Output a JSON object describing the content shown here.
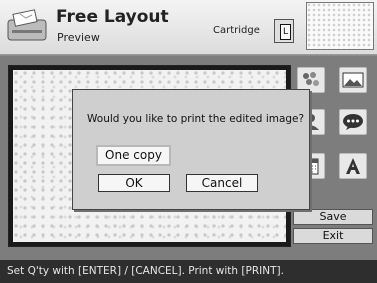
{
  "header": {
    "title": "Free Layout",
    "subtitle": "Preview",
    "cartridge_label": "Cartridge",
    "cartridge_size": "L"
  },
  "toolbar": {
    "icons": [
      "stamp-icon",
      "image-icon",
      "person-icon",
      "speech-bubble-icon",
      "calendar-icon",
      "text-icon"
    ]
  },
  "side_buttons": {
    "save": "Save",
    "exit": "Exit"
  },
  "dialog": {
    "message": "Would you like to print the edited image?",
    "copies_button": "One copy",
    "ok_button": "OK",
    "cancel_button": "Cancel"
  },
  "status_bar": {
    "text": "Set Q'ty with [ENTER] / [CANCEL]. Print with [PRINT]."
  },
  "colors": {
    "header_bg": "#e6e6e6",
    "main_bg": "#7d7d7d",
    "dialog_bg": "#cfcfcf",
    "status_bg": "#2e2e2e"
  }
}
